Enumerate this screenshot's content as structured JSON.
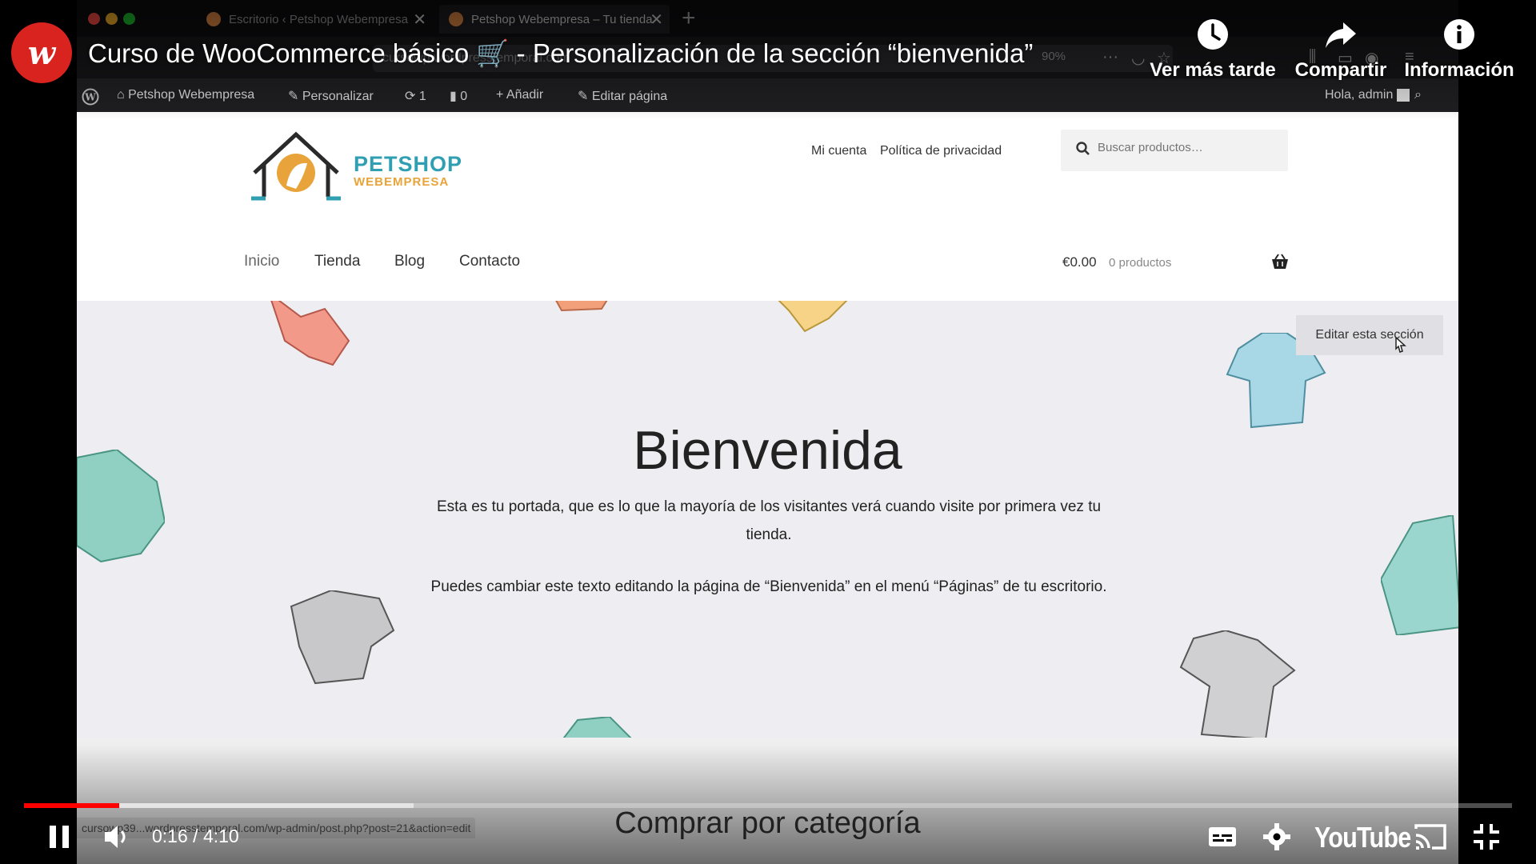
{
  "browser": {
    "tabs": [
      {
        "label": "Escritorio ‹ Petshop Webempresa"
      },
      {
        "label": "Petshop Webempresa – Tu tienda"
      }
    ],
    "url": "cursowp.wordpresstemporal.com",
    "zoom": "90%"
  },
  "adminbar": {
    "site_name": "Petshop Webempresa",
    "customize": "Personalizar",
    "updates": "1",
    "comments": "0",
    "add_new": "Añadir",
    "edit_page": "Editar página",
    "greeting": "Hola, admin"
  },
  "site": {
    "logo_line1": "PETSHOP",
    "logo_line2": "WEBEMPRESA",
    "secondary_nav": [
      "Mi cuenta",
      "Política de privacidad"
    ],
    "search_placeholder": "Buscar productos…",
    "primary_nav": [
      "Inicio",
      "Tienda",
      "Blog",
      "Contacto"
    ],
    "cart_total": "€0.00",
    "cart_count": "0 productos"
  },
  "hero": {
    "edit_section": "Editar esta sección",
    "title": "Bienvenida",
    "paragraph1": "Esta es tu portada, que es lo que la mayoría de los visitantes verá cuando visite por primera vez tu tienda.",
    "paragraph2": "Puedes cambiar este texto editando la página de “Bienvenida” en el menú “Páginas” de tu escritorio."
  },
  "below_hero": {
    "section_title": "Comprar por categoría",
    "status_url": "cursowp39...wordpresstemporal.com/wp-admin/post.php?post=21&action=edit"
  },
  "youtube": {
    "video_title": "Curso de WooCommerce básico 🛒 - Personalización de la sección “bienvenida”",
    "actions": {
      "watch_later": "Ver más tarde",
      "share": "Compartir",
      "info": "Información"
    },
    "current_time": "0:16",
    "duration": "4:10",
    "progress_fraction": 0.064,
    "buffered_fraction": 0.262,
    "logo": "YouTube",
    "channel_initial": "w"
  },
  "colors": {
    "progress_played": "#ff0000",
    "channel_brand": "#d9231f",
    "logo_teal": "#2f9fb1",
    "logo_orange": "#e8a43a"
  }
}
